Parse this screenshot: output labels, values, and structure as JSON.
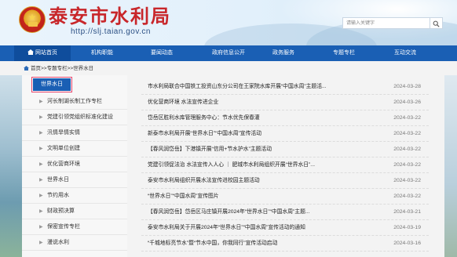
{
  "header": {
    "title": "泰安市水利局",
    "url": "http://slj.taian.gov.cn",
    "search_placeholder": "请输入关键字"
  },
  "nav": {
    "items": [
      {
        "label": "网站首页"
      },
      {
        "label": "机构职能"
      },
      {
        "label": "要闻动态"
      },
      {
        "label": "政府信息公开"
      },
      {
        "label": "政务服务"
      },
      {
        "label": "专题专栏"
      },
      {
        "label": "互动交流"
      }
    ]
  },
  "breadcrumb": {
    "text": "首页>>专题专栏>>世界水日"
  },
  "sidebar": {
    "heading": "世界水日",
    "items": [
      {
        "label": "河长制湖长制工作专栏"
      },
      {
        "label": "党建引领党组织标准化建设"
      },
      {
        "label": "汛情旱情实情"
      },
      {
        "label": "文明单位创建"
      },
      {
        "label": "优化营商环境"
      },
      {
        "label": "世界水日"
      },
      {
        "label": "节约用水"
      },
      {
        "label": "财政预决算"
      },
      {
        "label": "保密宣传专栏"
      },
      {
        "label": "漫说水利"
      }
    ]
  },
  "articles": [
    {
      "title": "市水利局联合中国铁工投资山东分公司在王家院水库开展“中国水周”主题活...",
      "date": "2024-03-28"
    },
    {
      "title": "优化营商环境 水法宣传进企业",
      "date": "2024-03-26"
    },
    {
      "title": "岱岳区胜利水库管理服务中心：节水优先保春灌",
      "date": "2024-03-22"
    },
    {
      "title": "新泰市水利局开展“世界水日”“中国水周”宣传活动",
      "date": "2024-03-22"
    },
    {
      "title": "【春风润岱岳】下港镇开展“信用+节水护水”主题活动",
      "date": "2024-03-22"
    },
    {
      "title": "党建引领促法治 水法宣传入人心 ｜ 肥城市水利局组织开展“世界水日”...",
      "date": "2024-03-22"
    },
    {
      "title": "泰安市水利局组织开展水法宣传进校园主题活动",
      "date": "2024-03-22"
    },
    {
      "title": "“世界水日”“中国水周”宣传图片",
      "date": "2024-03-22"
    },
    {
      "title": "【春风润岱岳】岱岳区马庄镇开展2024年“世界水日”“中国水周”主题...",
      "date": "2024-03-21"
    },
    {
      "title": "泰安市水利局关于开展2024年“世界水日”“中国水周”宣传活动的通知",
      "date": "2024-03-19"
    },
    {
      "title": "“千城地标亮节水”暨“节水中国，你我同行”宣传活动启动",
      "date": "2024-03-16"
    }
  ],
  "colors": {
    "nav_bg": "#1a5fb4",
    "title_red": "#c8262a",
    "highlight_outline": "#e8466d"
  }
}
